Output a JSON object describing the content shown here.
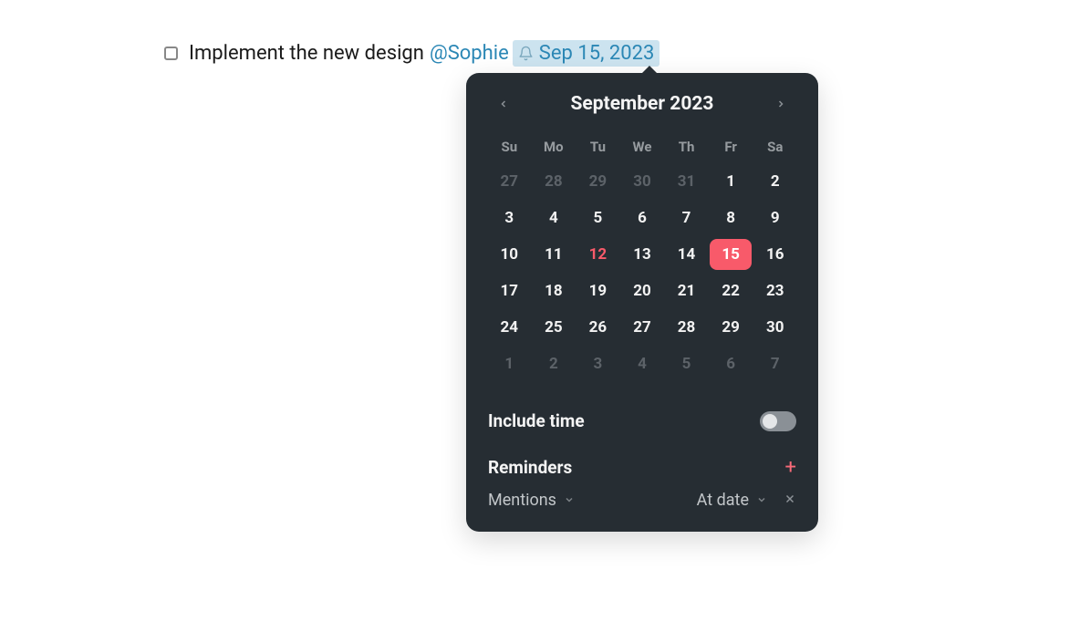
{
  "task": {
    "text": "Implement the new design",
    "mention": "@Sophie",
    "due_label": "Sep 15, 2023"
  },
  "calendar": {
    "title": "September 2023",
    "dow": [
      "Su",
      "Mo",
      "Tu",
      "We",
      "Th",
      "Fr",
      "Sa"
    ],
    "today": 12,
    "selected": 15,
    "cells": [
      {
        "n": 27,
        "out": true
      },
      {
        "n": 28,
        "out": true
      },
      {
        "n": 29,
        "out": true
      },
      {
        "n": 30,
        "out": true
      },
      {
        "n": 31,
        "out": true
      },
      {
        "n": 1
      },
      {
        "n": 2
      },
      {
        "n": 3
      },
      {
        "n": 4
      },
      {
        "n": 5
      },
      {
        "n": 6
      },
      {
        "n": 7
      },
      {
        "n": 8
      },
      {
        "n": 9
      },
      {
        "n": 10
      },
      {
        "n": 11
      },
      {
        "n": 12
      },
      {
        "n": 13
      },
      {
        "n": 14
      },
      {
        "n": 15
      },
      {
        "n": 16
      },
      {
        "n": 17
      },
      {
        "n": 18
      },
      {
        "n": 19
      },
      {
        "n": 20
      },
      {
        "n": 21
      },
      {
        "n": 22
      },
      {
        "n": 23
      },
      {
        "n": 24
      },
      {
        "n": 25
      },
      {
        "n": 26
      },
      {
        "n": 27
      },
      {
        "n": 28
      },
      {
        "n": 29
      },
      {
        "n": 30
      },
      {
        "n": 1,
        "out": true
      },
      {
        "n": 2,
        "out": true
      },
      {
        "n": 3,
        "out": true
      },
      {
        "n": 4,
        "out": true
      },
      {
        "n": 5,
        "out": true
      },
      {
        "n": 6,
        "out": true
      },
      {
        "n": 7,
        "out": true
      }
    ]
  },
  "options": {
    "include_time_label": "Include time",
    "include_time_on": false,
    "reminders_label": "Reminders",
    "reminder_type": "Mentions",
    "reminder_when": "At date"
  }
}
